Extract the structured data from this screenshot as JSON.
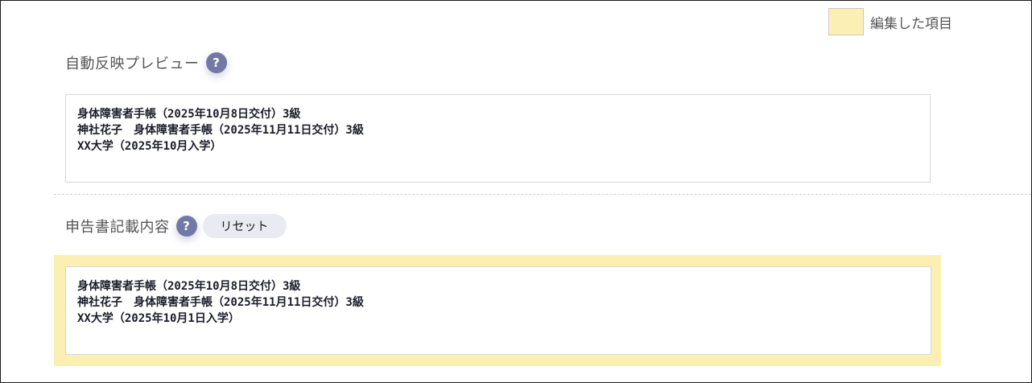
{
  "legend": {
    "label": "編集した項目",
    "swatch_color": "#fcefb3"
  },
  "preview": {
    "title": "自動反映プレビュー",
    "help": "?",
    "lines": [
      "身体障害者手帳（2025年10月8日交付）3級",
      "神社花子　身体障害者手帳（2025年11月11日交付）3級",
      "XX大学（2025年10月入学）"
    ]
  },
  "declaration": {
    "title": "申告書記載内容",
    "help": "?",
    "reset_label": "リセット",
    "lines": [
      "身体障害者手帳（2025年10月8日交付）3級",
      "神社花子　身体障害者手帳（2025年11月11日交付）3級",
      "XX大学（2025年10月1日入学）"
    ]
  }
}
